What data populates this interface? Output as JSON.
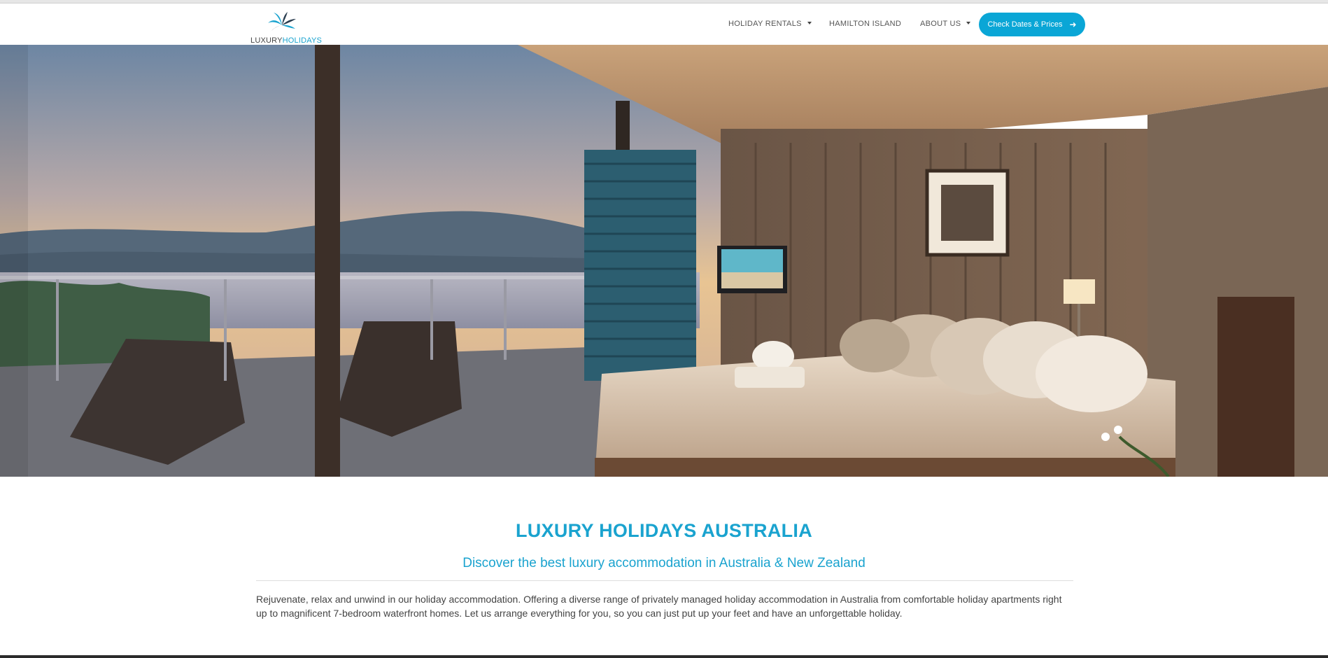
{
  "logo": {
    "text_part1": "LUXURY",
    "text_part2": "HOLIDAYS"
  },
  "nav": {
    "items": [
      {
        "label": "HOLIDAY RENTALS",
        "has_dropdown": true
      },
      {
        "label": "HAMILTON ISLAND",
        "has_dropdown": false
      },
      {
        "label": "ABOUT US",
        "has_dropdown": true
      }
    ],
    "cta_label": "Check Dates & Prices",
    "cta_icon": "arrow-right-icon"
  },
  "colors": {
    "accent": "#1aa3cf",
    "button": "#0aa6d6",
    "text": "#444444"
  },
  "main": {
    "title": "LUXURY HOLIDAYS AUSTRALIA",
    "subtitle": "Discover the best luxury accommodation in Australia & New Zealand",
    "intro": "Rejuvenate, relax and unwind in our holiday accommodation. Offering a diverse range of privately managed holiday accommodation in Australia from comfortable holiday apartments right up to magnificent 7-bedroom waterfront homes. Let us arrange everything for you, so you can just put up your feet and have an unforgettable holiday."
  }
}
